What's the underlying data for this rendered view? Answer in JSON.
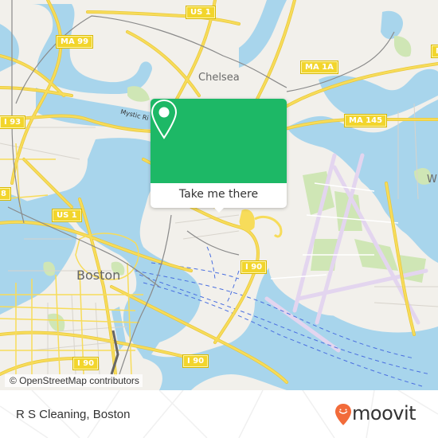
{
  "map": {
    "attribution": "© OpenStreetMap contributors",
    "places": {
      "chelsea": "Chelsea",
      "boston": "Boston",
      "winthrop_partial": "W"
    },
    "water_labels": {
      "mystic_river": "Mystic Ri"
    },
    "shields": {
      "us1_top": "US 1",
      "ma99": "MA 99",
      "ma1a": "MA 1A",
      "ma145": "MA 145",
      "i93": "I 93",
      "route_partial": "8",
      "us1_mid": "US 1",
      "i90_airport": "I 90",
      "i90_south_a": "I 90",
      "i90_south_b": "I 90",
      "partial_right": "M"
    },
    "colors": {
      "land": "#f2f0eb",
      "water": "#a8d5ec",
      "road": "#f7dc5a",
      "park": "#cfe6b5",
      "runway": "#e3d5ef"
    }
  },
  "popup": {
    "icon": "location-pin-icon",
    "button_label": "Take me there",
    "accent_color": "#1db866"
  },
  "footer": {
    "place_name": "R S Cleaning, Boston",
    "brand_name": "moovit",
    "brand_color": "#f26b3a"
  }
}
